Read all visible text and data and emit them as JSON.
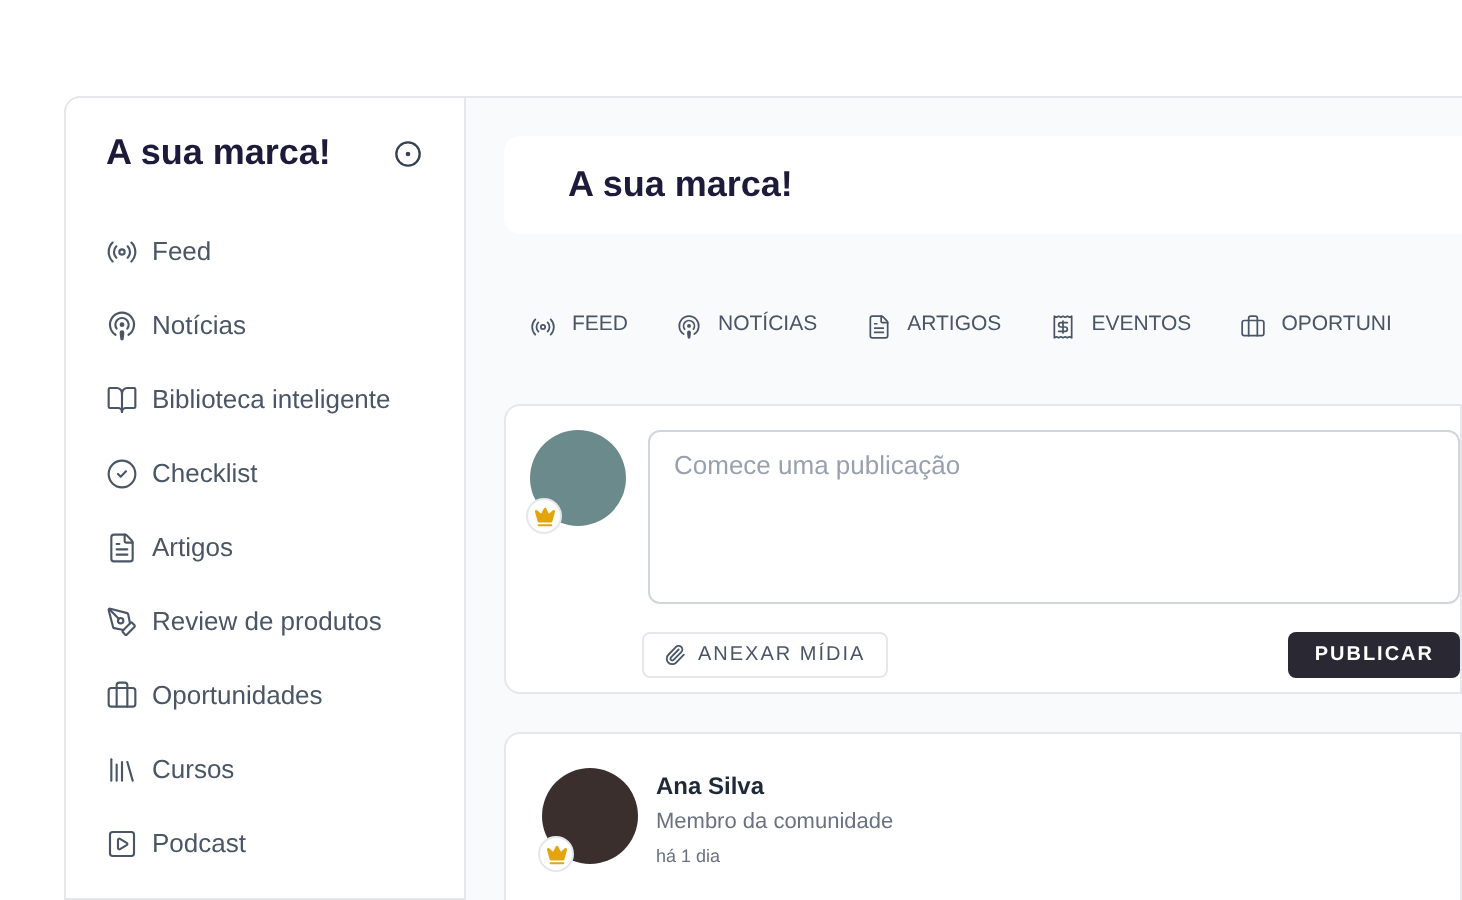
{
  "sidebar": {
    "title": "A sua marca!",
    "items": [
      {
        "label": "Feed",
        "kind": "feed"
      },
      {
        "label": "Notícias",
        "kind": "news"
      },
      {
        "label": "Biblioteca inteligente",
        "kind": "library"
      },
      {
        "label": "Checklist",
        "kind": "checklist"
      },
      {
        "label": "Artigos",
        "kind": "articles"
      },
      {
        "label": "Review de produtos",
        "kind": "review"
      },
      {
        "label": "Oportunidades",
        "kind": "jobs"
      },
      {
        "label": "Cursos",
        "kind": "courses"
      },
      {
        "label": "Podcast",
        "kind": "podcast"
      }
    ]
  },
  "header": {
    "title": "A sua marca!"
  },
  "tabs": [
    {
      "label": "FEED",
      "kind": "feed"
    },
    {
      "label": "NOTÍCIAS",
      "kind": "news"
    },
    {
      "label": "ARTIGOS",
      "kind": "articles"
    },
    {
      "label": "EVENTOS",
      "kind": "events"
    },
    {
      "label": "OPORTUNI",
      "kind": "jobs"
    }
  ],
  "composer": {
    "placeholder": "Comece uma publicação",
    "attach_button": "ANEXAR MÍDIA",
    "publish_button": "PUBLICAR"
  },
  "post": {
    "author": "Ana Silva",
    "role": "Membro da comunidade",
    "time": "há 1 dia"
  }
}
